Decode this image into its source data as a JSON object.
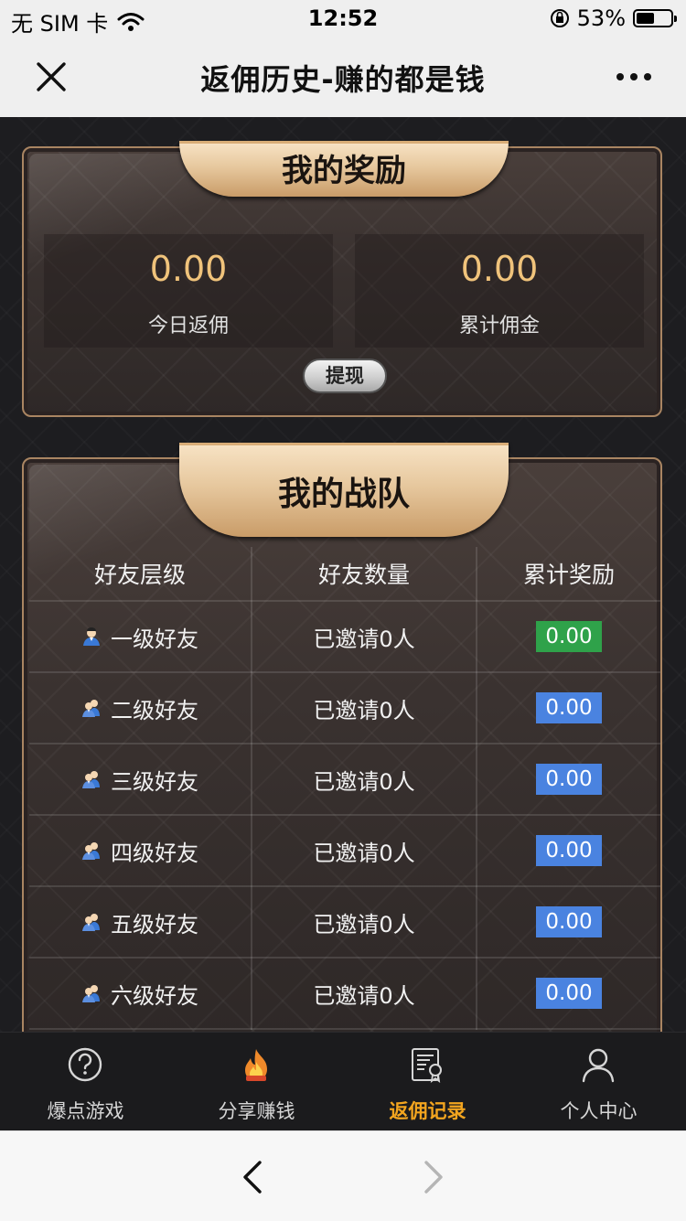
{
  "status_bar": {
    "carrier": "无 SIM 卡",
    "time": "12:52",
    "battery": "53%",
    "battery_level": 0.53
  },
  "nav": {
    "title": "返佣历史-赚的都是钱"
  },
  "rewards": {
    "title": "我的奖励",
    "today_value": "0.00",
    "today_label": "今日返佣",
    "total_value": "0.00",
    "total_label": "累计佣金",
    "withdraw_label": "提现"
  },
  "team": {
    "title": "我的战队",
    "headers": [
      "好友层级",
      "好友数量",
      "累计奖励"
    ],
    "rows": [
      {
        "level": "一级好友",
        "count": "已邀请0人",
        "reward": "0.00",
        "badge_color": "#2fa24a",
        "icon": "single-user-icon"
      },
      {
        "level": "二级好友",
        "count": "已邀请0人",
        "reward": "0.00",
        "badge_color": "#4a83e0",
        "icon": "multi-user-icon"
      },
      {
        "level": "三级好友",
        "count": "已邀请0人",
        "reward": "0.00",
        "badge_color": "#4a83e0",
        "icon": "multi-user-icon"
      },
      {
        "level": "四级好友",
        "count": "已邀请0人",
        "reward": "0.00",
        "badge_color": "#4a83e0",
        "icon": "multi-user-icon"
      },
      {
        "level": "五级好友",
        "count": "已邀请0人",
        "reward": "0.00",
        "badge_color": "#4a83e0",
        "icon": "multi-user-icon"
      },
      {
        "level": "六级好友",
        "count": "已邀请0人",
        "reward": "0.00",
        "badge_color": "#4a83e0",
        "icon": "multi-user-icon"
      }
    ]
  },
  "tabbar": {
    "items": [
      {
        "label": "爆点游戏",
        "icon": "question-circle-icon",
        "active": false
      },
      {
        "label": "分享赚钱",
        "icon": "flame-icon",
        "active": false
      },
      {
        "label": "返佣记录",
        "icon": "certificate-icon",
        "active": true
      },
      {
        "label": "个人中心",
        "icon": "person-icon",
        "active": false
      }
    ],
    "active_color": "#f3a51f",
    "inactive_color": "#d6d6d6"
  }
}
